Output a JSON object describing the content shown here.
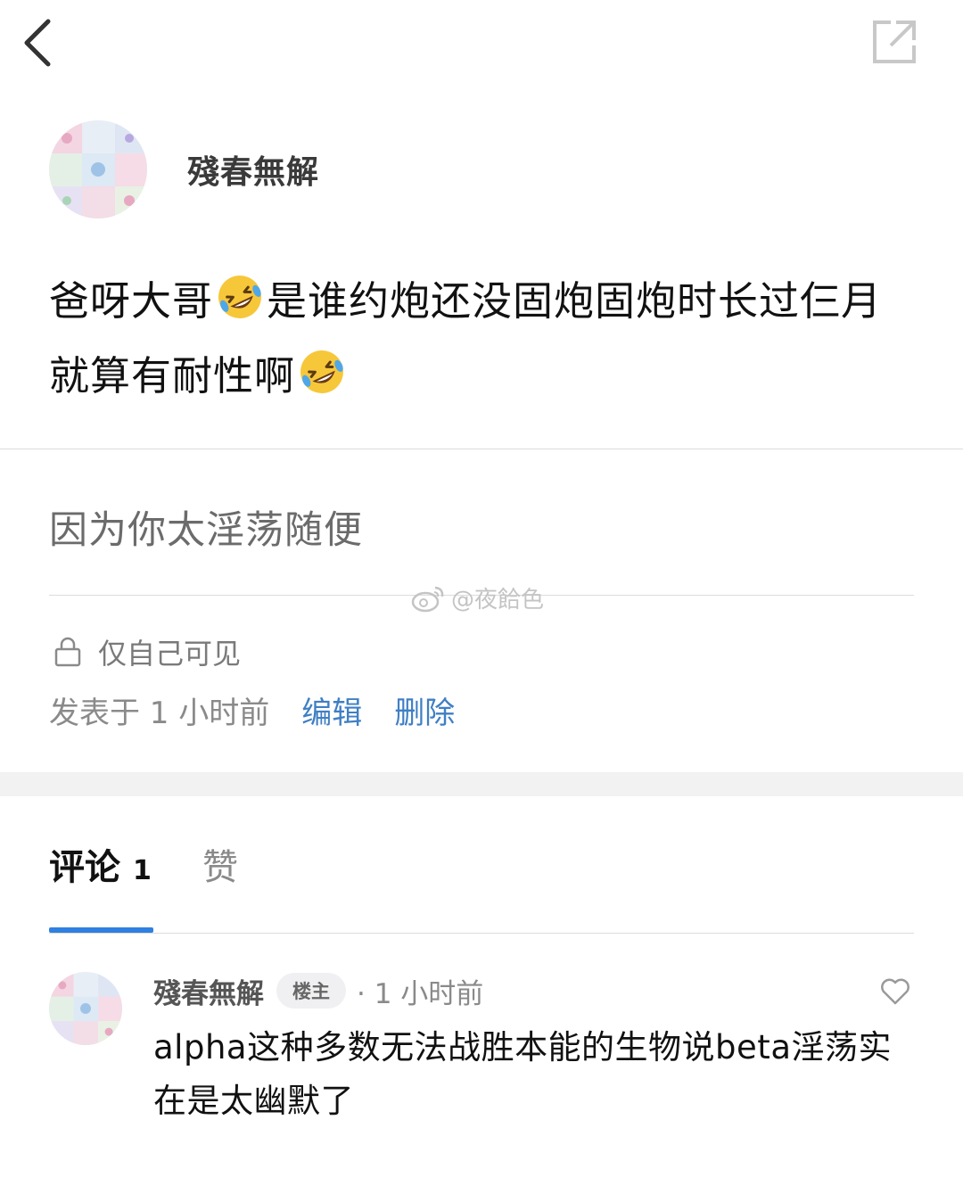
{
  "post": {
    "author": "殘春無解",
    "text_part1": "爸呀大哥",
    "text_part2": "是谁约炮还没固炮固炮时长过仨月就算有耐性啊",
    "emoji": "rolling-on-floor-laughing"
  },
  "reply": {
    "text": "因为你太淫荡随便"
  },
  "watermark": {
    "text": "@夜餄色"
  },
  "privacy": {
    "label": "仅自己可见"
  },
  "meta": {
    "posted": "发表于 1 小时前",
    "edit_label": "编辑",
    "delete_label": "删除"
  },
  "tabs": {
    "comments_label": "评论",
    "comments_count": "1",
    "likes_label": "赞"
  },
  "comment": {
    "author": "殘春無解",
    "badge": "楼主",
    "time": "· 1 小时前",
    "text": "alpha这种多数无法战胜本能的生物说beta淫荡实在是太幽默了"
  },
  "colors": {
    "accent": "#2f80e0",
    "link": "#3f7fc4",
    "muted": "#8a8a8a"
  }
}
